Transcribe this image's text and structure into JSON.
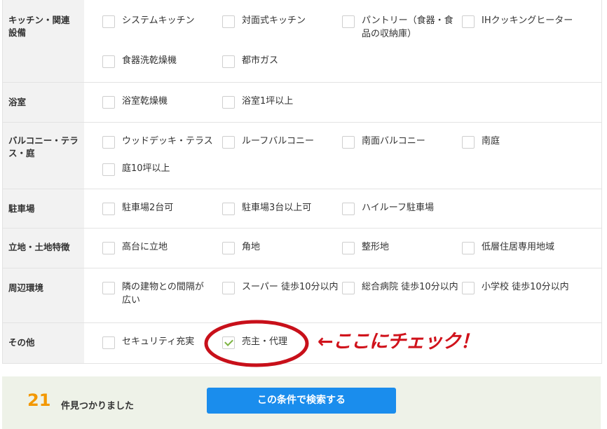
{
  "rows": [
    {
      "heading": "キッチン・関連\n設備",
      "options": [
        {
          "label": "システムキッチン",
          "checked": false
        },
        {
          "label": "対面式キッチン",
          "checked": false
        },
        {
          "label": "パントリー（食器・食品の収納庫）",
          "checked": false
        },
        {
          "label": "IHクッキングヒーター",
          "checked": false
        },
        {
          "label": "食器洗乾燥機",
          "checked": false
        },
        {
          "label": "都市ガス",
          "checked": false
        }
      ]
    },
    {
      "heading": "浴室",
      "options": [
        {
          "label": "浴室乾燥機",
          "checked": false
        },
        {
          "label": "浴室1坪以上",
          "checked": false
        }
      ]
    },
    {
      "heading": "バルコニー・テラス・庭",
      "options": [
        {
          "label": "ウッドデッキ・テラス",
          "checked": false
        },
        {
          "label": "ルーフバルコニー",
          "checked": false
        },
        {
          "label": "南面バルコニー",
          "checked": false
        },
        {
          "label": "南庭",
          "checked": false
        },
        {
          "label": "庭10坪以上",
          "checked": false
        }
      ]
    },
    {
      "heading": "駐車場",
      "options": [
        {
          "label": "駐車場2台可",
          "checked": false
        },
        {
          "label": "駐車場3台以上可",
          "checked": false
        },
        {
          "label": "ハイルーフ駐車場",
          "checked": false
        }
      ]
    },
    {
      "heading": "立地・土地特徴",
      "options": [
        {
          "label": "高台に立地",
          "checked": false
        },
        {
          "label": "角地",
          "checked": false
        },
        {
          "label": "整形地",
          "checked": false
        },
        {
          "label": "低層住居専用地域",
          "checked": false
        }
      ]
    },
    {
      "heading": "周辺環境",
      "options": [
        {
          "label": "隣の建物との間隔が広い",
          "checked": false
        },
        {
          "label": "スーパー 徒歩10分以内",
          "checked": false
        },
        {
          "label": "総合病院 徒歩10分以内",
          "checked": false
        },
        {
          "label": "小学校 徒歩10分以内",
          "checked": false
        }
      ]
    },
    {
      "heading": "その他",
      "options": [
        {
          "label": "セキュリティ充実",
          "checked": false
        },
        {
          "label": "売主・代理",
          "checked": true
        }
      ]
    }
  ],
  "footer": {
    "count": "21",
    "count_suffix": "件見つかりました",
    "search_button": "この条件で検索する"
  },
  "annotation": {
    "text": "←ここにチェック！",
    "color": "#d0121b"
  }
}
